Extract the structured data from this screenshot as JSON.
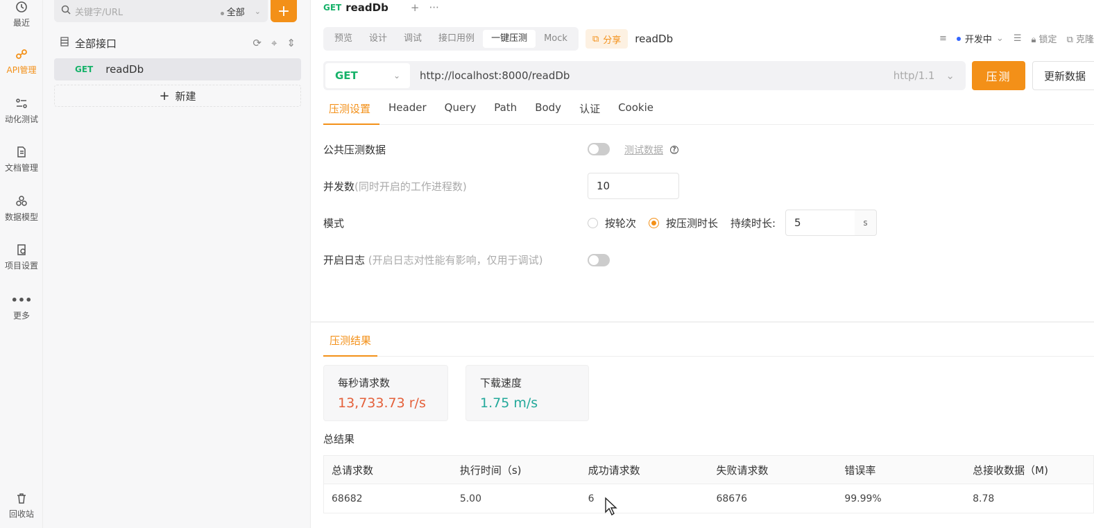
{
  "rail": {
    "items": [
      {
        "label": "最近",
        "icon": "history-icon"
      },
      {
        "label": "API管理",
        "icon": "api-icon"
      },
      {
        "label": "动化测试",
        "icon": "automation-icon"
      },
      {
        "label": "文档管理",
        "icon": "document-icon"
      },
      {
        "label": "数据模型",
        "icon": "data-model-icon"
      },
      {
        "label": "项目设置",
        "icon": "settings-icon"
      },
      {
        "label": "更多",
        "icon": "more-icon"
      },
      {
        "label": "回收站",
        "icon": "trash-icon"
      }
    ]
  },
  "tree": {
    "search_placeholder": "关键字/URL",
    "scope": "全部",
    "add_label": "+",
    "header": "全部接口",
    "item": {
      "method": "GET",
      "name": "readDb"
    },
    "new_label": "新建"
  },
  "tabbar": {
    "method": "GET",
    "title": "readDb"
  },
  "subbar": {
    "tabs": [
      "预览",
      "设计",
      "调试",
      "接口用例",
      "一键压测",
      "Mock"
    ],
    "share": "分享",
    "name": "readDb",
    "status": "开发中",
    "lock": "锁定",
    "clone": "克隆"
  },
  "urlbar": {
    "method": "GET",
    "url": "http://localhost:8000/readDb",
    "protocol": "http/1.1",
    "run": "压测",
    "update": "更新数据"
  },
  "param_tabs": [
    "压测设置",
    "Header",
    "Query",
    "Path",
    "Body",
    "认证",
    "Cookie"
  ],
  "settings": {
    "public_data": "公共压测数据",
    "test_data": "测试数据",
    "concurrency_label": "并发数",
    "concurrency_hint": "(同时开启的工作进程数)",
    "concurrency_value": "10",
    "mode_label": "模式",
    "mode_by_rounds": "按轮次",
    "mode_by_duration": "按压测时长",
    "duration_label": "持续时长:",
    "duration_value": "5",
    "duration_unit": "s",
    "log_label": "开启日志",
    "log_hint": "(开启日志对性能有影响，仅用于调试)"
  },
  "results": {
    "tab": "压测结果",
    "rps_label": "每秒请求数",
    "rps_value": "13,733.73 r/s",
    "download_label": "下载速度",
    "download_value": "1.75 m/s",
    "total_label": "总结果",
    "columns": [
      "总请求数",
      "执行时间（s)",
      "成功请求数",
      "失败请求数",
      "错误率",
      "总接收数据（M)"
    ],
    "row": [
      "68682",
      "5.00",
      "6",
      "68676",
      "99.99%",
      "8.78"
    ]
  },
  "colors": {
    "accent": "#f39018",
    "get": "#17b26a",
    "rps": "#e4603a",
    "download": "#22a89a"
  }
}
